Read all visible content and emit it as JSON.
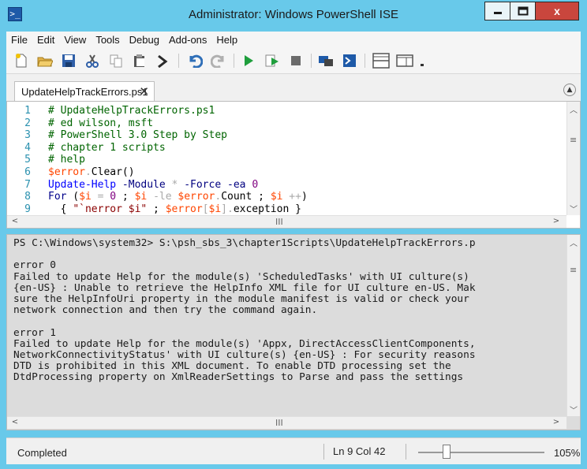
{
  "window": {
    "title": "Administrator: Windows PowerShell ISE",
    "buttons": {
      "minimize": "—",
      "maximize": "□",
      "close": "x"
    }
  },
  "menu": [
    "File",
    "Edit",
    "View",
    "Tools",
    "Debug",
    "Add-ons",
    "Help"
  ],
  "toolbar": {
    "icons": [
      "new-icon",
      "open-icon",
      "save-icon",
      "cut-icon",
      "copy-icon",
      "paste-icon",
      "clear-console-icon",
      "undo-icon",
      "redo-icon",
      "run-icon",
      "run-selection-icon",
      "stop-icon",
      "remote-powershell-icon",
      "start-powershell-icon",
      "show-script-pane-top-icon",
      "show-script-pane-right-icon",
      "overflow-icon"
    ]
  },
  "tab": {
    "label": "UpdateHelpTrackErrors.ps1",
    "close": "✕"
  },
  "editor": {
    "lines": [
      {
        "n": "1",
        "tokens": [
          [
            "c-com",
            "# UpdateHelpTrackErrors.ps1"
          ]
        ]
      },
      {
        "n": "2",
        "tokens": [
          [
            "c-com",
            "# ed wilson, msft"
          ]
        ]
      },
      {
        "n": "3",
        "tokens": [
          [
            "c-com",
            "# PowerShell 3.0 Step by Step"
          ]
        ]
      },
      {
        "n": "4",
        "tokens": [
          [
            "c-com",
            "# chapter 1 scripts"
          ]
        ]
      },
      {
        "n": "5",
        "tokens": [
          [
            "c-com",
            "# help"
          ]
        ]
      },
      {
        "n": "6",
        "tokens": [
          [
            "c-var",
            "$error"
          ],
          [
            "c-op",
            "."
          ],
          [
            "c-mem",
            "Clear()"
          ]
        ]
      },
      {
        "n": "7",
        "tokens": [
          [
            "c-cmd",
            "Update-Help"
          ],
          [
            "c-mem",
            " "
          ],
          [
            "c-par",
            "-Module"
          ],
          [
            "c-mem",
            " "
          ],
          [
            "c-op",
            "*"
          ],
          [
            "c-mem",
            " "
          ],
          [
            "c-par",
            "-Force"
          ],
          [
            "c-mem",
            " "
          ],
          [
            "c-par",
            "-ea"
          ],
          [
            "c-mem",
            " "
          ],
          [
            "c-num",
            "0"
          ]
        ]
      },
      {
        "n": "8",
        "tokens": [
          [
            "c-kw",
            "For"
          ],
          [
            "c-mem",
            " ("
          ],
          [
            "c-var",
            "$i"
          ],
          [
            "c-mem",
            " "
          ],
          [
            "c-op",
            "="
          ],
          [
            "c-mem",
            " "
          ],
          [
            "c-num",
            "0"
          ],
          [
            "c-mem",
            " ; "
          ],
          [
            "c-var",
            "$i"
          ],
          [
            "c-mem",
            " "
          ],
          [
            "c-op",
            "-le"
          ],
          [
            "c-mem",
            " "
          ],
          [
            "c-var",
            "$error"
          ],
          [
            "c-op",
            "."
          ],
          [
            "c-mem",
            "Count ; "
          ],
          [
            "c-var",
            "$i"
          ],
          [
            "c-mem",
            " "
          ],
          [
            "c-op",
            "++"
          ],
          [
            "c-mem",
            ")"
          ]
        ]
      },
      {
        "n": "9",
        "tokens": [
          [
            "c-mem",
            "  { "
          ],
          [
            "c-str",
            "\"`nerror $i\""
          ],
          [
            "c-mem",
            " ; "
          ],
          [
            "c-var",
            "$error"
          ],
          [
            "c-op",
            "["
          ],
          [
            "c-var",
            "$i"
          ],
          [
            "c-op",
            "]"
          ],
          [
            "c-op",
            "."
          ],
          [
            "c-mem",
            "exception }"
          ]
        ]
      }
    ]
  },
  "console": {
    "lines": [
      "PS C:\\Windows\\system32> S:\\psh_sbs_3\\chapter1Scripts\\UpdateHelpTrackErrors.p",
      "",
      "error 0",
      "Failed to update Help for the module(s) 'ScheduledTasks' with UI culture(s)",
      "{en-US} : Unable to retrieve the HelpInfo XML file for UI culture en-US. Mak",
      "sure the HelpInfoUri property in the module manifest is valid or check your",
      "network connection and then try the command again.",
      "",
      "error 1",
      "Failed to update Help for the module(s) 'Appx, DirectAccessClientComponents,",
      "NetworkConnectivityStatus' with UI culture(s) {en-US} : For security reasons",
      "DTD is prohibited in this XML document. To enable DTD processing set the",
      "DtdProcessing property on XmlReaderSettings to Parse and pass the settings"
    ]
  },
  "status": {
    "text": "Completed",
    "position": "Ln 9  Col 42",
    "zoom": "105%",
    "zoom_level_percent": 105
  },
  "scroll": {
    "grip": "≡",
    "thumb": "III"
  }
}
